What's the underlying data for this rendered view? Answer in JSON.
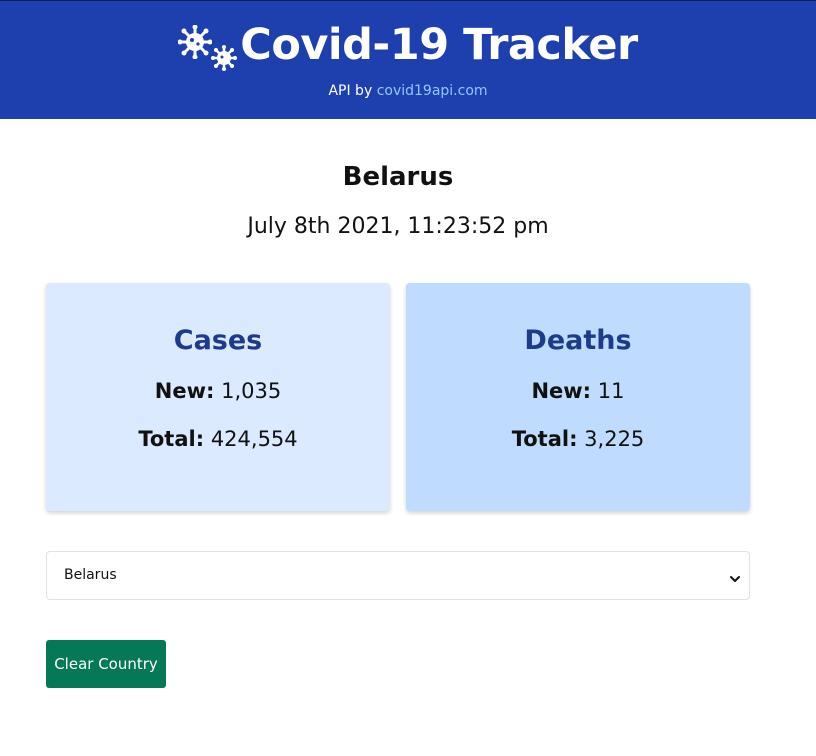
{
  "header": {
    "title": "Covid-19 Tracker",
    "api_prefix": "API by",
    "api_link": "covid19api.com",
    "icon": "virus-icon",
    "background": "#1e40af",
    "link_color": "#93c5fd"
  },
  "country": {
    "name": "Belarus",
    "timestamp": "July 8th 2021, 11:23:52 pm"
  },
  "cards": {
    "cases": {
      "title": "Cases",
      "new_label": "New:",
      "new_value": "1,035",
      "total_label": "Total:",
      "total_value": "424,554",
      "background": "#dbeafe"
    },
    "deaths": {
      "title": "Deaths",
      "new_label": "New:",
      "new_value": "11",
      "total_label": "Total:",
      "total_value": "3,225",
      "background": "#bfdbfe"
    }
  },
  "country_select": {
    "selected": "Belarus",
    "icon": "chevron-down-icon"
  },
  "clear_button": {
    "label": "Clear Country",
    "color": "#047857"
  }
}
